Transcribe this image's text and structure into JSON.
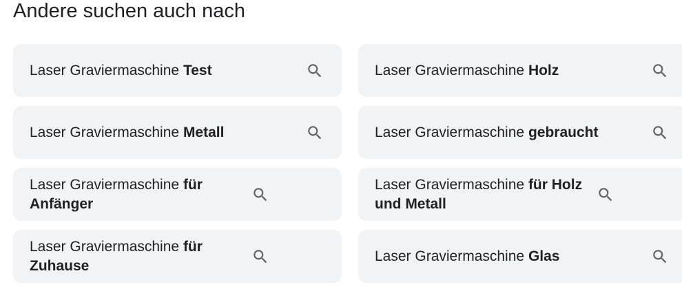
{
  "section": {
    "title": "Andere suchen auch nach"
  },
  "suggestions": [
    {
      "prefix": "Laser Graviermaschine",
      "suffix": "Test"
    },
    {
      "prefix": "Laser Graviermaschine",
      "suffix": "Holz"
    },
    {
      "prefix": "Laser Graviermaschine",
      "suffix": "Metall"
    },
    {
      "prefix": "Laser Graviermaschine",
      "suffix": "gebraucht"
    },
    {
      "prefix": "Laser Graviermaschine",
      "suffix": "für Anfänger"
    },
    {
      "prefix": "Laser Graviermaschine",
      "suffix": "für Holz und Metall"
    },
    {
      "prefix": "Laser Graviermaschine",
      "suffix": "für Zuhause"
    },
    {
      "prefix": "Laser Graviermaschine",
      "suffix": "Glas"
    }
  ],
  "icons": {
    "search": "search-icon"
  },
  "colors": {
    "chip_background": "#f1f3f4",
    "text": "#202124",
    "icon": "#5f6368"
  }
}
